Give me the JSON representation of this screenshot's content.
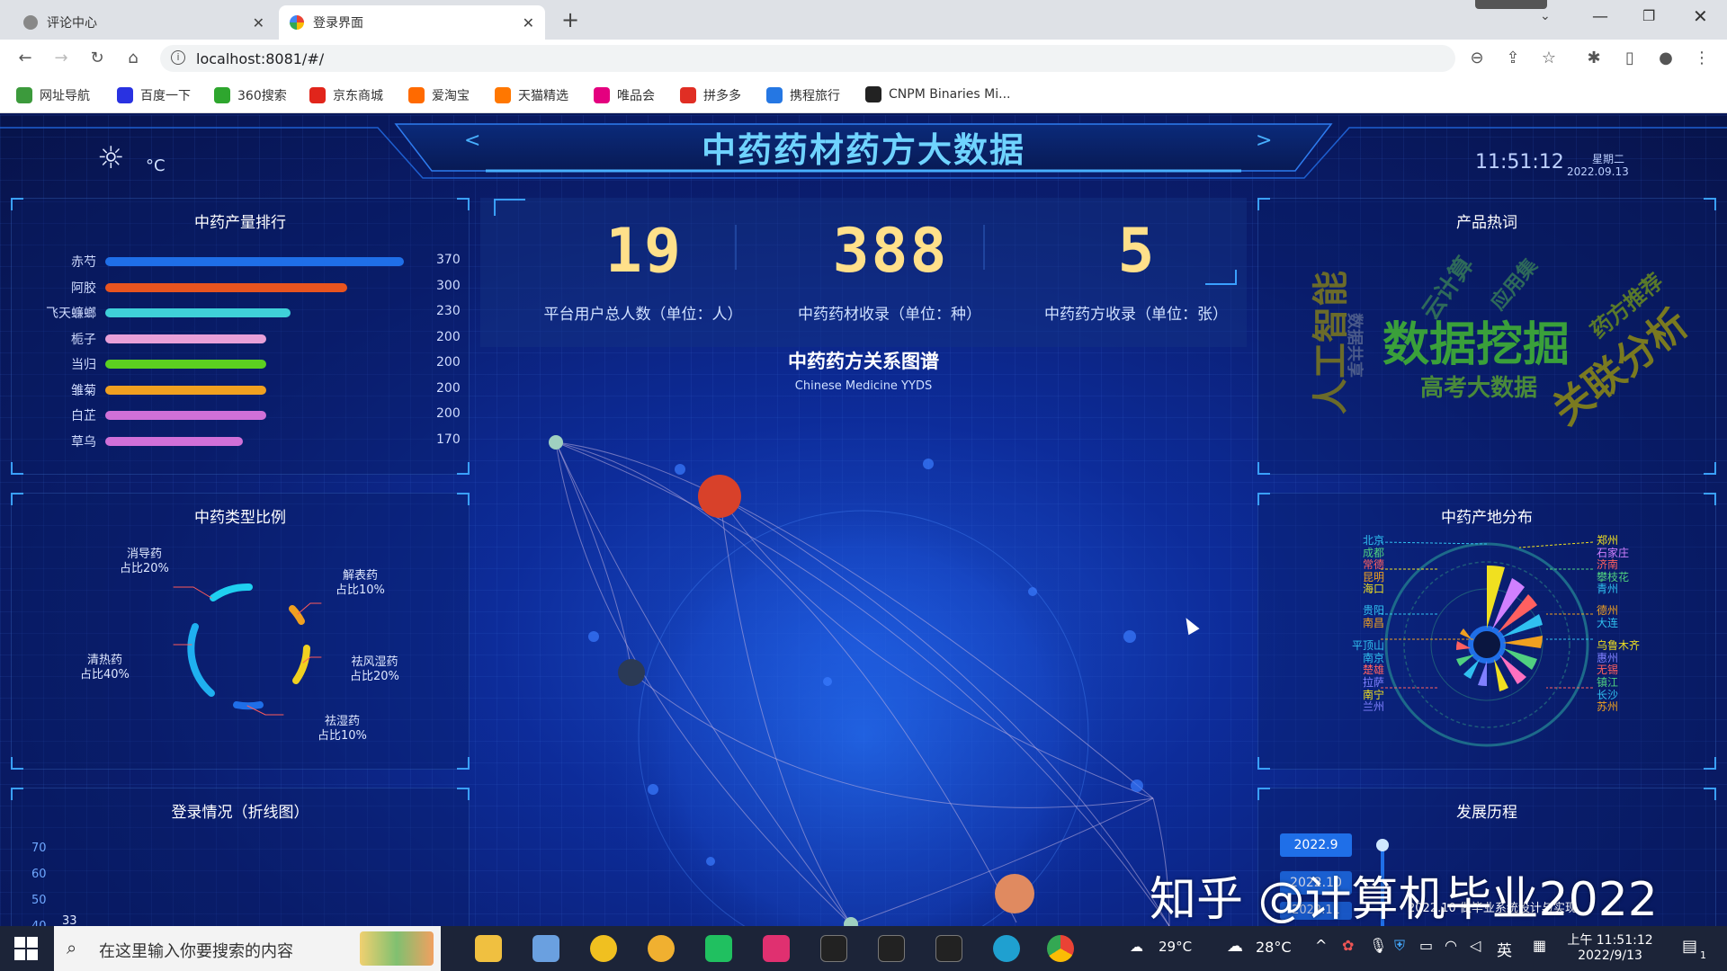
{
  "browser": {
    "tabs": [
      {
        "label": "评论中心",
        "icon": "globe-icon"
      },
      {
        "label": "登录界面",
        "icon": "google-icon"
      }
    ],
    "url": "localhost:8081/#/",
    "bookmarks": [
      {
        "label": "网址导航",
        "color": "#3c9a3c"
      },
      {
        "label": "百度一下",
        "color": "#2932e1"
      },
      {
        "label": "360搜索",
        "color": "#2ea62e"
      },
      {
        "label": "京东商城",
        "color": "#e1251b"
      },
      {
        "label": "爱淘宝",
        "color": "#ff6a00"
      },
      {
        "label": "天猫精选",
        "color": "#ff7700"
      },
      {
        "label": "唯品会",
        "color": "#e4007f"
      },
      {
        "label": "拼多多",
        "color": "#e02e24"
      },
      {
        "label": "携程旅行",
        "color": "#2577e3"
      },
      {
        "label": "CNPM Binaries Mi...",
        "color": "#222222"
      }
    ]
  },
  "header": {
    "title": "中药药材药方大数据",
    "temp_unit": "°C",
    "time": "11:51:12",
    "weekday": "星期二",
    "date": "2022.09.13",
    "prev": "<",
    "next": ">"
  },
  "ranking": {
    "title": "中药产量排行",
    "items": [
      {
        "label": "赤芍",
        "value": 370,
        "color": "#1f6fe8"
      },
      {
        "label": "阿胶",
        "value": 300,
        "color": "#e8541f"
      },
      {
        "label": "飞天蠊螂",
        "value": 230,
        "color": "#3fd0d8"
      },
      {
        "label": "栀子",
        "value": 200,
        "color": "#e8a0d8"
      },
      {
        "label": "当归",
        "value": 200,
        "color": "#5cd020"
      },
      {
        "label": "雏菊",
        "value": 200,
        "color": "#f0a020"
      },
      {
        "label": "白芷",
        "value": 200,
        "color": "#d070d8"
      },
      {
        "label": "草乌",
        "value": 170,
        "color": "#d070d8"
      }
    ]
  },
  "types": {
    "title": "中药类型比例",
    "items": [
      {
        "name": "消导药",
        "ratio": "占比20%"
      },
      {
        "name": "解表药",
        "ratio": "占比10%"
      },
      {
        "name": "祛风湿药",
        "ratio": "占比20%"
      },
      {
        "name": "祛湿药",
        "ratio": "占比10%"
      },
      {
        "name": "清热药",
        "ratio": "占比40%"
      }
    ]
  },
  "login": {
    "title": "登录情况（折线图）",
    "yticks": [
      "70",
      "60",
      "50",
      "40"
    ],
    "first_value": "33"
  },
  "stats": [
    {
      "value": "19",
      "label": "平台用户总人数（单位：人）"
    },
    {
      "value": "388",
      "label": "中药药材收录（单位：种）"
    },
    {
      "value": "5",
      "label": "中药药方收录（单位：张）"
    }
  ],
  "graph": {
    "title": "中药药方关系图谱",
    "subtitle": "Chinese Medicine YYDS"
  },
  "hotwords": {
    "title": "产品热词",
    "words": [
      "数据挖掘",
      "关联分析",
      "人工智能",
      "高考大数据",
      "药方推荐",
      "云计算",
      "应用集",
      "数据共享"
    ]
  },
  "origin": {
    "title": "中药产地分布",
    "left": [
      "北京",
      "成都",
      "常德",
      "昆明",
      "海口",
      "贵阳",
      "南昌",
      "平顶山",
      "南京",
      "楚雄",
      "拉萨",
      "南宁",
      "兰州"
    ],
    "right": [
      "郑州",
      "石家庄",
      "济南",
      "攀枝花",
      "青州",
      "德州",
      "大连",
      "乌鲁木齐",
      "惠州",
      "无锡",
      "镇江",
      "长沙",
      "苏州"
    ]
  },
  "history": {
    "title": "发展历程",
    "entries": [
      "2022.9",
      "2022.10",
      "2022.11"
    ],
    "note": "2022.10 做毕业系统设计与实现"
  },
  "watermark": "知乎 @计算机毕业2022",
  "taskbar": {
    "search_placeholder": "在这里输入你要搜索的内容",
    "weather1": "29°C",
    "weather2": "28°C",
    "ime": "英",
    "time": "上午 11:51:12",
    "date": "2022/9/13",
    "notif": "1"
  }
}
